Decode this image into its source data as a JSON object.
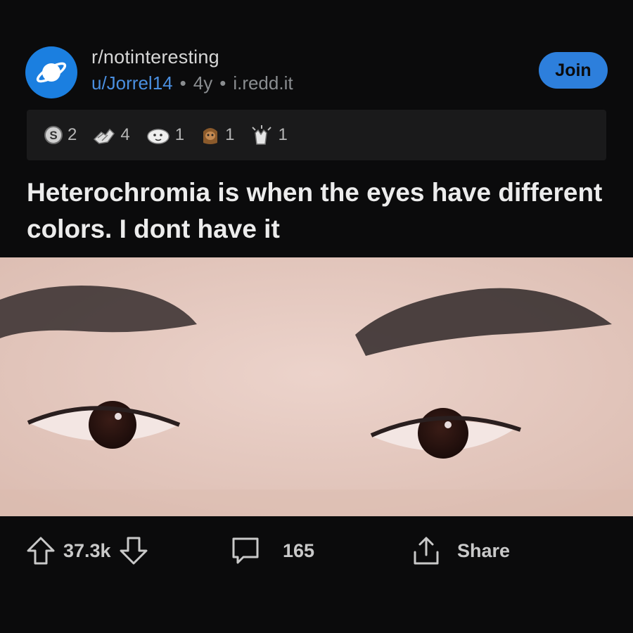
{
  "post": {
    "subreddit": "r/notinteresting",
    "username": "u/Jorrel14",
    "age": "4y",
    "source": "i.redd.it",
    "join_label": "Join",
    "title": "Heterochromia is when the eyes have different colors. I dont have it"
  },
  "awards": [
    {
      "icon": "silver-coin-award-icon",
      "count": "2"
    },
    {
      "icon": "helpful-hands-award-icon",
      "count": "4"
    },
    {
      "icon": "wholesome-seal-award-icon",
      "count": "1"
    },
    {
      "icon": "ewok-bear-award-icon",
      "count": "1"
    },
    {
      "icon": "clapping-hands-award-icon",
      "count": "1"
    }
  ],
  "actions": {
    "upvotes": "37.3k",
    "comments": "165",
    "share_label": "Share"
  },
  "colors": {
    "background": "#0b0b0c",
    "accent": "#2d7fdc",
    "username": "#4a8fe0"
  }
}
